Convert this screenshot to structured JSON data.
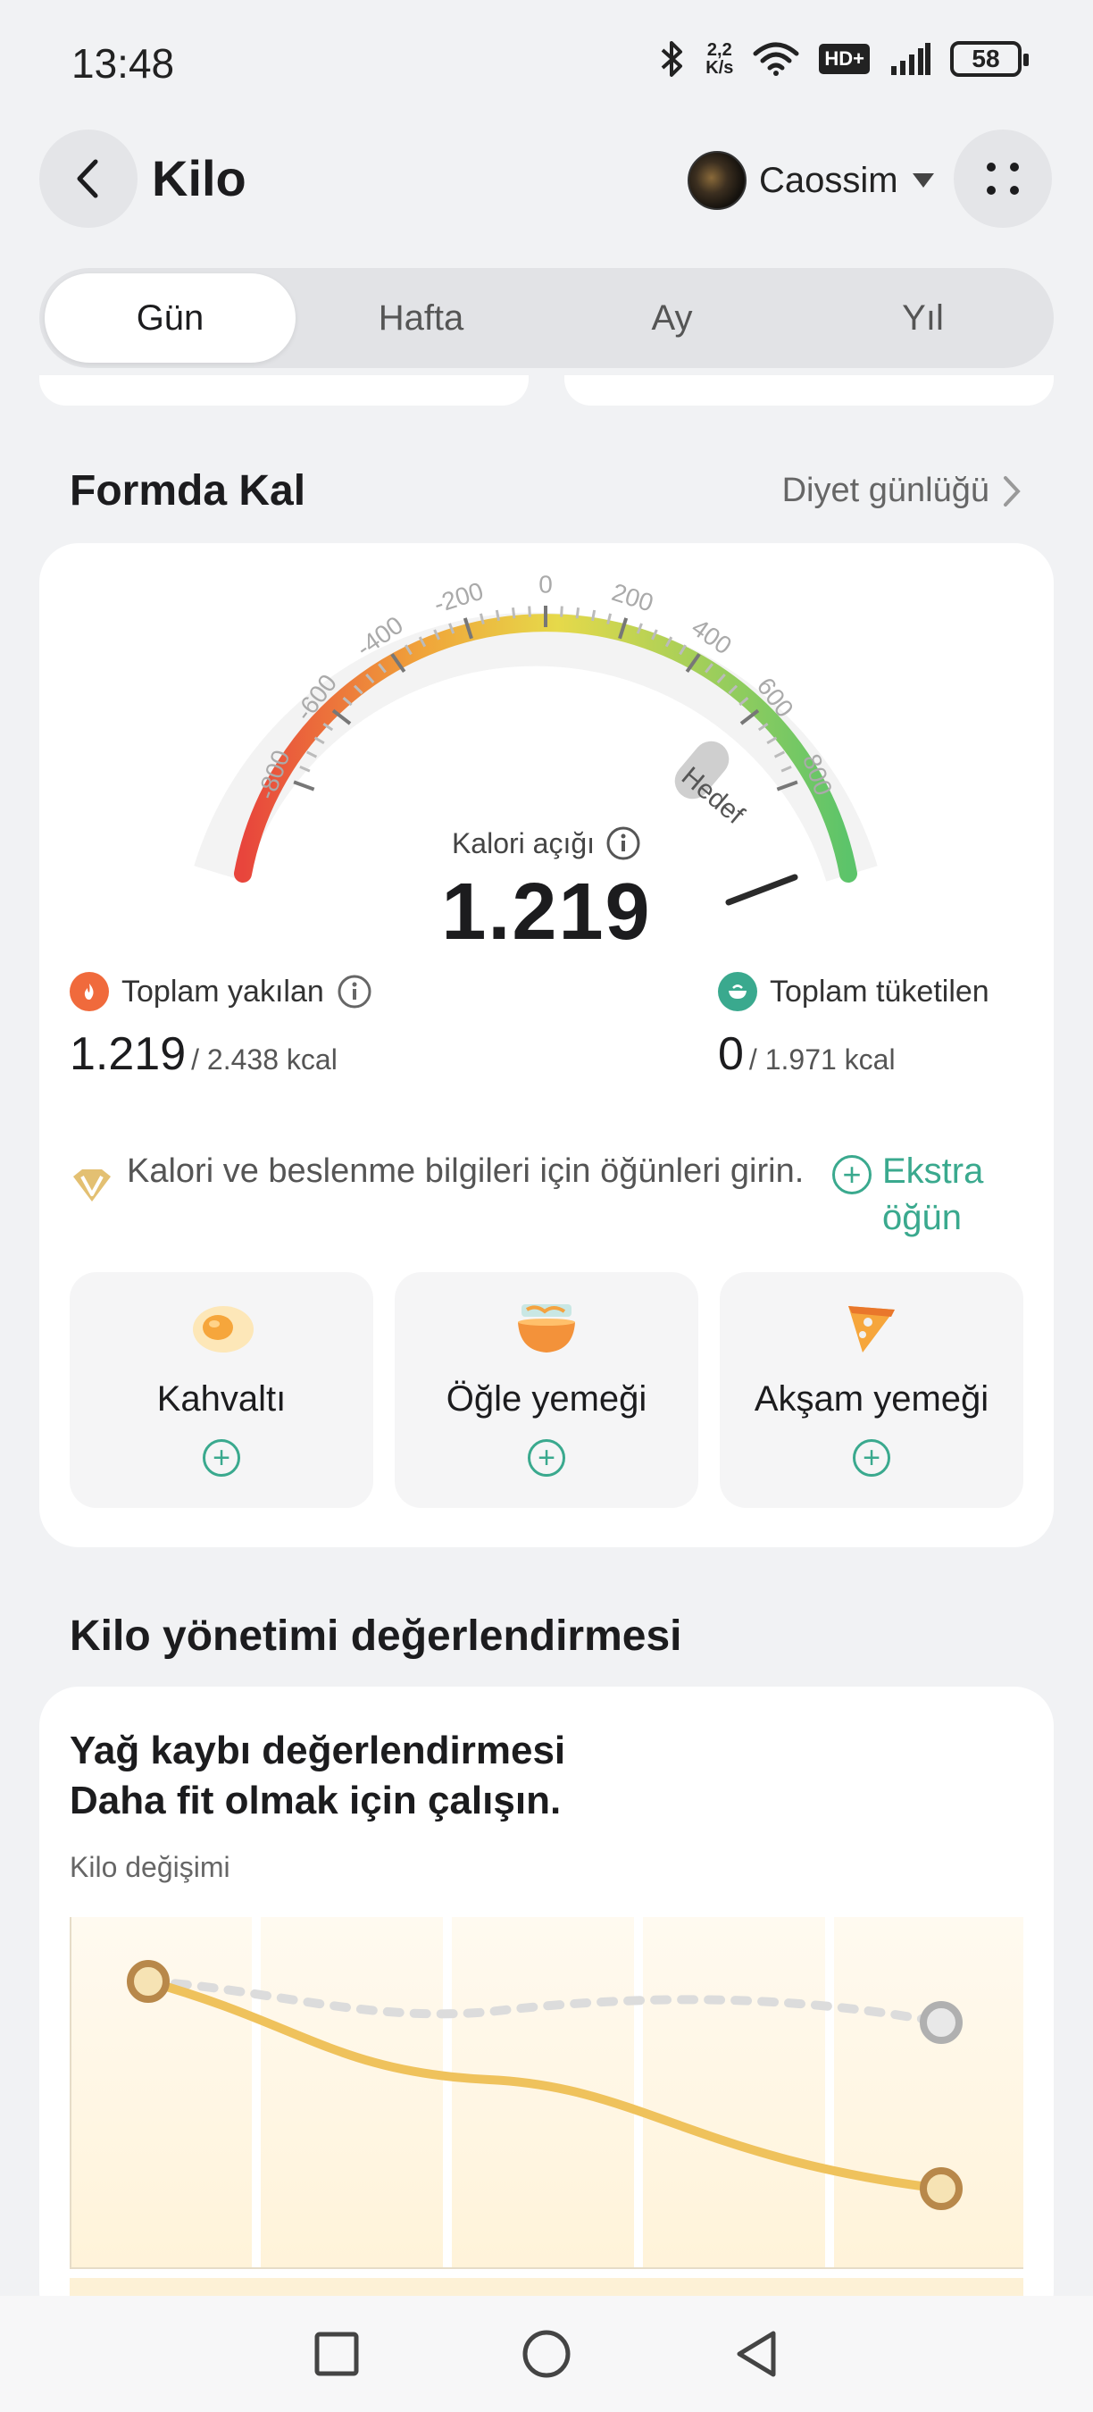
{
  "status_bar": {
    "time": "13:48",
    "net_speed_value": "2,2",
    "net_speed_unit": "K/s",
    "hd_label": "HD+",
    "battery": "58"
  },
  "header": {
    "title": "Kilo",
    "user_name": "Caossim"
  },
  "tabs": [
    {
      "label": "Gün",
      "active": true
    },
    {
      "label": "Hafta",
      "active": false
    },
    {
      "label": "Ay",
      "active": false
    },
    {
      "label": "Yıl",
      "active": false
    }
  ],
  "fit_section": {
    "title": "Formda Kal",
    "diary_link": "Diyet günlüğü",
    "gauge": {
      "ticks": [
        "-800",
        "-600",
        "-400",
        "-200",
        "0",
        "200",
        "400",
        "600",
        "800"
      ],
      "target_label": "Hedef",
      "label": "Kalori açığı",
      "value": "1.219",
      "colors": [
        "#e8453c",
        "#f0a53a",
        "#e6d94a",
        "#5cc46a"
      ]
    },
    "burned": {
      "label": "Toplam yakılan",
      "value": "1.219",
      "total": "/ 2.438 kcal"
    },
    "consumed": {
      "label": "Toplam tüketilen",
      "value": "0",
      "total": "/ 1.971 kcal"
    },
    "info_text": "Kalori ve beslenme bilgileri için öğünleri girin.",
    "extra_meal_line1": "Ekstra",
    "extra_meal_line2": "öğün",
    "meals": [
      {
        "name": "Kahvaltı",
        "icon": "egg-icon"
      },
      {
        "name": "Öğle yemeği",
        "icon": "bowl-icon"
      },
      {
        "name": "Akşam yemeği",
        "icon": "pizza-icon"
      }
    ]
  },
  "weight_section": {
    "title": "Kilo yönetimi değerlendirmesi",
    "card_title_line1": "Yağ kaybı değerlendirmesi",
    "card_title_line2": "Daha fit olmak için çalışın.",
    "chart_label": "Kilo değişimi"
  }
}
